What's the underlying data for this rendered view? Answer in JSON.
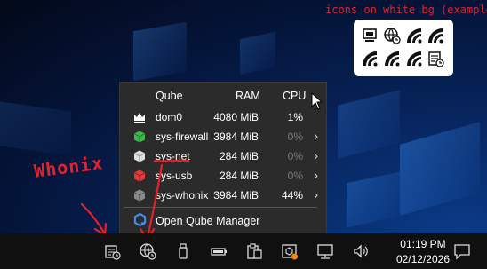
{
  "annotations": {
    "example_label": "icons on white bg (example)",
    "whonix_note": "Whonix"
  },
  "example_icons": [
    "network-icon",
    "globe-clock-icon",
    "wifi-icon",
    "wifi-icon",
    "wifi-icon",
    "wifi-icon",
    "wifi-icon",
    "calendar-clock-icon"
  ],
  "menu": {
    "headers": {
      "name": "Qube",
      "ram": "RAM",
      "cpu": "CPU"
    },
    "qubes": [
      {
        "name": "dom0",
        "ram": "4080 MiB",
        "cpu": "1%",
        "cpu_dim": false,
        "has_submenu": false,
        "icon": "crown-icon",
        "color": "#ffffff"
      },
      {
        "name": "sys-firewall",
        "ram": "3984 MiB",
        "cpu": "0%",
        "cpu_dim": true,
        "has_submenu": true,
        "icon": "cube-icon",
        "color": "#3dbb4a"
      },
      {
        "name": "sys-net",
        "ram": "284 MiB",
        "cpu": "0%",
        "cpu_dim": true,
        "has_submenu": true,
        "icon": "cube-icon",
        "color": "#e0e0e0"
      },
      {
        "name": "sys-usb",
        "ram": "284 MiB",
        "cpu": "0%",
        "cpu_dim": true,
        "has_submenu": true,
        "icon": "cube-icon",
        "color": "#e33b3b"
      },
      {
        "name": "sys-whonix",
        "ram": "3984 MiB",
        "cpu": "44%",
        "cpu_dim": false,
        "has_submenu": true,
        "icon": "cube-icon",
        "color": "#8a8a8a"
      }
    ],
    "manager_label": "Open Qube Manager"
  },
  "taskbar": {
    "tray_icons": [
      "calendar-clock-icon",
      "globe-clock-icon",
      "usb-drive-icon",
      "battery-icon",
      "clipboard-icon",
      "cube-alert-icon",
      "network-monitor-icon",
      "volume-icon"
    ],
    "time": "01:19 PM",
    "date": "02/12/2026",
    "notification_icon": "notification-icon"
  },
  "colors": {
    "annotation": "#e8202a",
    "menu_bg": "#2b2b2b",
    "taskbar_bg": "#101010"
  }
}
